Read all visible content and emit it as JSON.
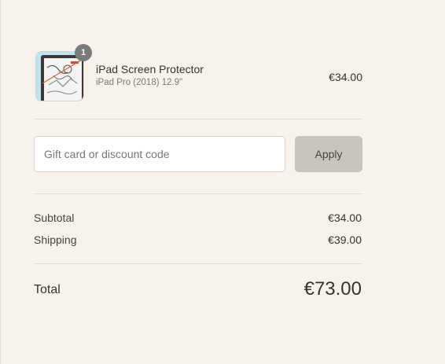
{
  "order_summary": {
    "product": {
      "quantity": "1",
      "title": "iPad Screen Protector",
      "variant": "iPad Pro (2018) 12.9\"",
      "price": "€34.00",
      "thumbnail_icon": "ipad-sketch-product-image"
    },
    "discount": {
      "placeholder": "Gift card or discount code",
      "value": "",
      "apply_label": "Apply"
    },
    "subtotal_label": "Subtotal",
    "subtotal_value": "€34.00",
    "shipping_label": "Shipping",
    "shipping_value": "€39.00",
    "total_label": "Total",
    "total_value": "€73.00"
  },
  "colors": {
    "background": "#f7f3ec",
    "apply_button": "#c9c5bd",
    "badge": "#7b7b7b",
    "divider": "#e1dbd1"
  }
}
